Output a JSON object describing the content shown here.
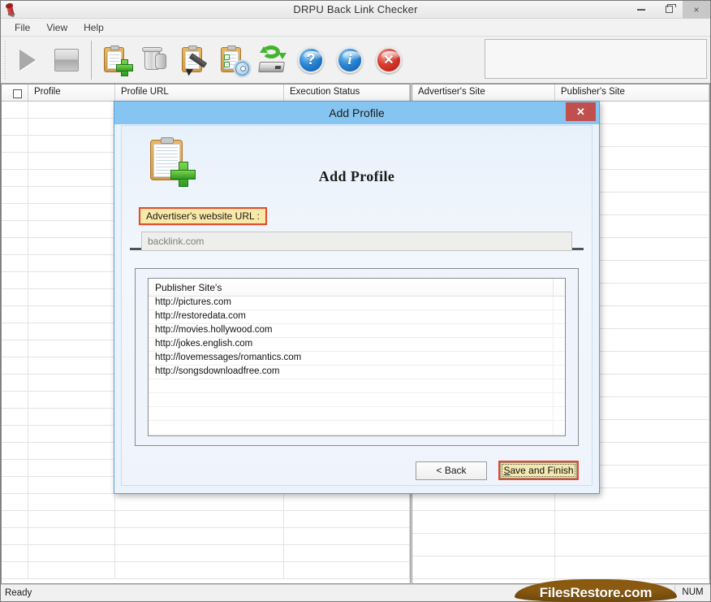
{
  "window": {
    "title": "DRPU Back Link Checker",
    "app_icon": "app-logo-icon",
    "controls": {
      "minimize": "minimize-icon",
      "maximize": "restore-icon",
      "close": "×"
    }
  },
  "menu": {
    "items": [
      {
        "label": "File"
      },
      {
        "label": "View"
      },
      {
        "label": "Help"
      }
    ]
  },
  "toolbar": {
    "buttons": [
      {
        "name": "start-button",
        "icon": "play-icon",
        "enabled": false
      },
      {
        "name": "stop-button",
        "icon": "stop-icon",
        "enabled": false
      },
      {
        "name": "add-profile-button",
        "icon": "clipboard-plus-icon",
        "enabled": true
      },
      {
        "name": "delete-profile-button",
        "icon": "trash-icon",
        "enabled": true
      },
      {
        "name": "edit-profile-button",
        "icon": "clipboard-pen-icon",
        "enabled": true
      },
      {
        "name": "profile-settings-button",
        "icon": "clipboard-gear-icon",
        "enabled": true
      },
      {
        "name": "backup-restore-button",
        "icon": "disk-refresh-icon",
        "enabled": true
      },
      {
        "name": "help-button",
        "icon": "question-orb-icon",
        "glyph": "?",
        "enabled": true
      },
      {
        "name": "about-button",
        "icon": "info-orb-icon",
        "glyph": "i",
        "enabled": true
      },
      {
        "name": "exit-button",
        "icon": "close-orb-icon",
        "glyph": "✕",
        "enabled": true
      }
    ]
  },
  "grid_left": {
    "columns": [
      "",
      "Profile",
      "Profile URL",
      "Execution Status"
    ],
    "rows": [],
    "empty_row_count": 28
  },
  "grid_right": {
    "columns": [
      "Advertiser's Site",
      "Publisher's Site"
    ],
    "rows": [],
    "empty_row_count": 21
  },
  "status_bar": {
    "message": "Ready",
    "num_indicator": "NUM",
    "watermark": "FilesRestore.com"
  },
  "dialog": {
    "title": "Add Profile",
    "close_label": "✕",
    "heading": "Add Profile",
    "icon": "clipboard-plus-icon",
    "url_label": "Advertiser's website URL :",
    "url_value": "backlink.com",
    "url_placeholder": "backlink.com",
    "list": {
      "header": "Publisher Site's",
      "items": [
        "http://pictures.com",
        "http://restoredata.com",
        "http://movies.hollywood.com",
        "http://jokes.english.com",
        "http://lovemessages/romantics.com",
        "http://songsdownloadfree.com"
      ],
      "empty_row_count": 6
    },
    "buttons": {
      "back": "< Back",
      "save_mnemonic": "S",
      "save_rest": "ave and Finish"
    }
  },
  "colors": {
    "dialog_title_bg": "#86c5f2",
    "dialog_close_bg": "#c0504d",
    "highlight_label_bg": "#f9e9a8",
    "highlight_border": "#e04a2f",
    "save_button_bg": "#f3e8b0",
    "watermark_bg": "#8a5a11",
    "accent_green": "#2f9b23"
  }
}
